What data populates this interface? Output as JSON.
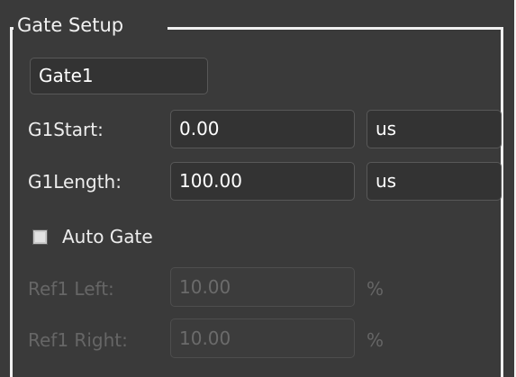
{
  "gate_setup": {
    "title": "Gate Setup",
    "gate_selector": "Gate1",
    "start": {
      "label": "G1Start:",
      "value": "0.00",
      "unit": "us"
    },
    "length": {
      "label": "G1Length:",
      "value": "100.00",
      "unit": "us"
    },
    "auto_gate": {
      "label": "Auto Gate",
      "checked": false
    },
    "ref_left": {
      "label": "Ref1 Left:",
      "value": "10.00",
      "unit": "%"
    },
    "ref_right": {
      "label": "Ref1 Right:",
      "value": "10.00",
      "unit": "%"
    }
  }
}
